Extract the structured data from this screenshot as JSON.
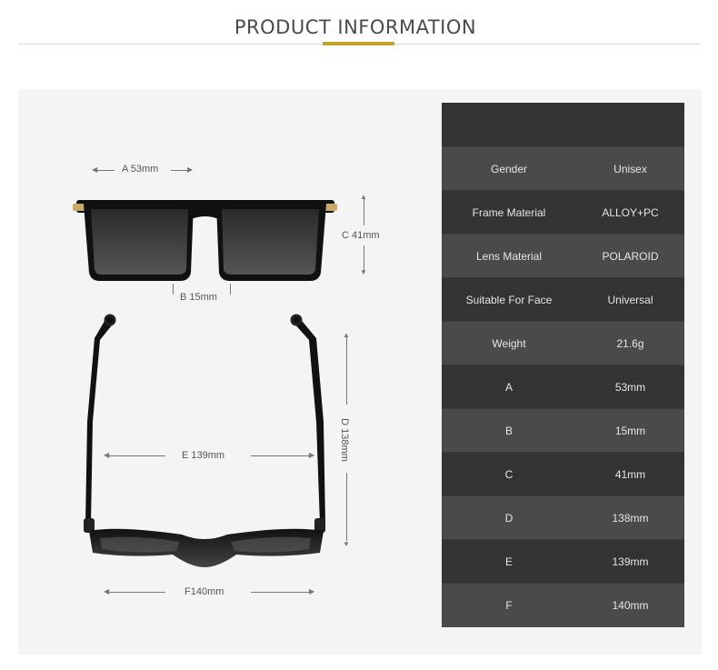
{
  "header": {
    "title": "PRODUCT INFORMATION",
    "accent_color": "#c9a227"
  },
  "dimensions": {
    "a": "A 53mm",
    "b": "B 15mm",
    "c": "C 41mm",
    "d": "D 138mm",
    "e": "E 139mm",
    "f": "F140mm"
  },
  "specs": [
    {
      "label": "Gender",
      "value": "Unisex"
    },
    {
      "label": "Frame Material",
      "value": "ALLOY+PC"
    },
    {
      "label": "Lens Material",
      "value": "POLAROID"
    },
    {
      "label": "Suitable For Face",
      "value": "Universal"
    },
    {
      "label": "Weight",
      "value": "21.6g"
    },
    {
      "label": "A",
      "value": "53mm"
    },
    {
      "label": "B",
      "value": "15mm"
    },
    {
      "label": "C",
      "value": "41mm"
    },
    {
      "label": "D",
      "value": "138mm"
    },
    {
      "label": "E",
      "value": "139mm"
    },
    {
      "label": "F",
      "value": "140mm"
    }
  ]
}
